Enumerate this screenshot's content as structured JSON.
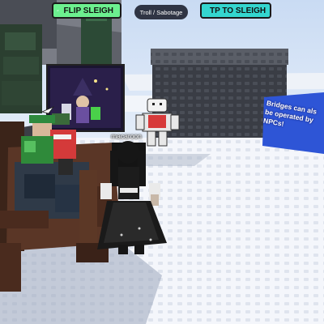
{
  "hud": {
    "flip_sleigh_label": "FLIP SLEIGH",
    "tp_to_sleigh_label": "TP TO SLEIGH",
    "mode_label": "Troll / Sabotage"
  },
  "world": {
    "player_name": "macaroon",
    "sign_lines": [
      "Bridges can als",
      "be operated by",
      "NPCs!"
    ]
  },
  "colors": {
    "flip_button": "#6cf08f",
    "tp_button": "#34d6cf",
    "sky": "#cfdff3",
    "floor": "#f4f6fb",
    "wall": "#3a3d45",
    "sign_panel": "#2e55d6"
  }
}
